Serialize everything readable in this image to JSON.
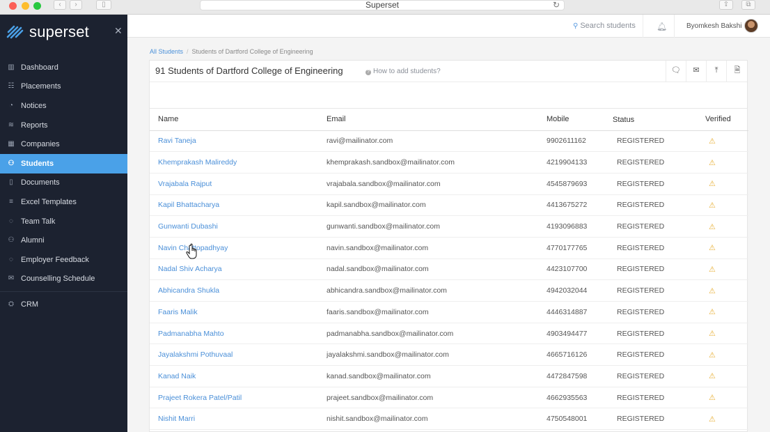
{
  "window": {
    "title": "Superset"
  },
  "brand": {
    "name": "superset"
  },
  "sidebar": {
    "items": [
      {
        "label": "Dashboard",
        "icon": "dashboard-icon",
        "glyph": "▥"
      },
      {
        "label": "Placements",
        "icon": "placements-icon",
        "glyph": "☷"
      },
      {
        "label": "Notices",
        "icon": "notices-icon",
        "glyph": "◔"
      },
      {
        "label": "Reports",
        "icon": "reports-icon",
        "glyph": "≋"
      },
      {
        "label": "Companies",
        "icon": "companies-icon",
        "glyph": "▦"
      },
      {
        "label": "Students",
        "icon": "students-icon",
        "glyph": "⚇",
        "active": true
      },
      {
        "label": "Documents",
        "icon": "documents-icon",
        "glyph": "▯"
      },
      {
        "label": "Excel Templates",
        "icon": "excel-templates-icon",
        "glyph": "≡"
      },
      {
        "label": "Team Talk",
        "icon": "team-talk-icon",
        "glyph": "◌"
      },
      {
        "label": "Alumni",
        "icon": "alumni-icon",
        "glyph": "⚇"
      },
      {
        "label": "Employer Feedback",
        "icon": "employer-feedback-icon",
        "glyph": "◌"
      },
      {
        "label": "Counselling Schedule",
        "icon": "counselling-schedule-icon",
        "glyph": "✉"
      },
      {
        "label": "CRM",
        "icon": "crm-icon",
        "glyph": "⛭"
      }
    ]
  },
  "topbar": {
    "search_label": "Search students",
    "user_name": "Byomkesh Bakshi"
  },
  "breadcrumb": {
    "root": "All Students",
    "current": "Students of Dartford College of Engineering"
  },
  "page": {
    "title": "91 Students of Dartford College of Engineering",
    "help_link": "How to add students?"
  },
  "table": {
    "columns": {
      "name": "Name",
      "email": "Email",
      "mobile": "Mobile",
      "status": "Status",
      "verified": "Verified"
    },
    "rows": [
      {
        "name": "Ravi Taneja",
        "email": "ravi@mailinator.com",
        "mobile": "9902611162",
        "status": "REGISTERED"
      },
      {
        "name": "Khemprakash Malireddy",
        "email": "khemprakash.sandbox@mailinator.com",
        "mobile": "4219904133",
        "status": "REGISTERED"
      },
      {
        "name": "Vrajabala Rajput",
        "email": "vrajabala.sandbox@mailinator.com",
        "mobile": "4545879693",
        "status": "REGISTERED"
      },
      {
        "name": "Kapil Bhattacharya",
        "email": "kapil.sandbox@mailinator.com",
        "mobile": "4413675272",
        "status": "REGISTERED"
      },
      {
        "name": "Gunwanti Dubashi",
        "email": "gunwanti.sandbox@mailinator.com",
        "mobile": "4193096883",
        "status": "REGISTERED"
      },
      {
        "name": "Navin Chattopadhyay",
        "email": "navin.sandbox@mailinator.com",
        "mobile": "4770177765",
        "status": "REGISTERED"
      },
      {
        "name": "Nadal Shiv Acharya",
        "email": "nadal.sandbox@mailinator.com",
        "mobile": "4423107700",
        "status": "REGISTERED"
      },
      {
        "name": "Abhicandra Shukla",
        "email": "abhicandra.sandbox@mailinator.com",
        "mobile": "4942032044",
        "status": "REGISTERED"
      },
      {
        "name": "Faaris Malik",
        "email": "faaris.sandbox@mailinator.com",
        "mobile": "4446314887",
        "status": "REGISTERED"
      },
      {
        "name": "Padmanabha Mahto",
        "email": "padmanabha.sandbox@mailinator.com",
        "mobile": "4903494477",
        "status": "REGISTERED"
      },
      {
        "name": "Jayalakshmi Pothuvaal",
        "email": "jayalakshmi.sandbox@mailinator.com",
        "mobile": "4665716126",
        "status": "REGISTERED"
      },
      {
        "name": "Kanad Naik",
        "email": "kanad.sandbox@mailinator.com",
        "mobile": "4472847598",
        "status": "REGISTERED"
      },
      {
        "name": "Prajeet Rokera Patel/Patil",
        "email": "prajeet.sandbox@mailinator.com",
        "mobile": "4662935563",
        "status": "REGISTERED"
      },
      {
        "name": "Nishit Marri",
        "email": "nishit.sandbox@mailinator.com",
        "mobile": "4750548001",
        "status": "REGISTERED"
      }
    ]
  },
  "colors": {
    "accent": "#4aa1e8",
    "sidebar_bg": "#1c2230",
    "link": "#4a8fd8",
    "warning": "#e8b13a"
  }
}
